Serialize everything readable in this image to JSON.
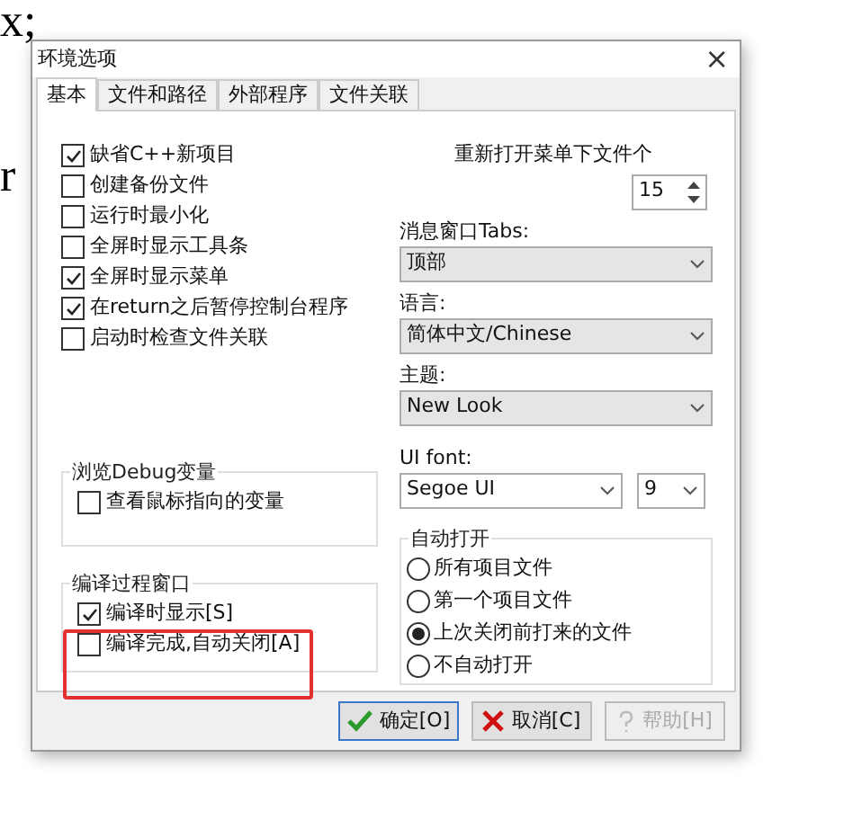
{
  "background_text": [
    "x;",
    "r"
  ],
  "window": {
    "title": "环境选项",
    "close": "×"
  },
  "tabs": [
    {
      "label": "基本",
      "selected": true
    },
    {
      "label": "文件和路径",
      "selected": false
    },
    {
      "label": "外部程序",
      "selected": false
    },
    {
      "label": "文件关联",
      "selected": false
    }
  ],
  "options": [
    {
      "label": "缺省C++新项目",
      "checked": true
    },
    {
      "label": "创建备份文件",
      "checked": false
    },
    {
      "label": "运行时最小化",
      "checked": false
    },
    {
      "label": "全屏时显示工具条",
      "checked": false
    },
    {
      "label": "全屏时显示菜单",
      "checked": true
    },
    {
      "label": "在return之后暂停控制台程序",
      "checked": true
    },
    {
      "label": "启动时检查文件关联",
      "checked": false
    }
  ],
  "debug_group": {
    "title": "浏览Debug变量",
    "options": [
      {
        "label": "查看鼠标指向的变量",
        "checked": false
      }
    ]
  },
  "compile_group": {
    "title": "编译过程窗口",
    "options": [
      {
        "label": "编译时显示[S]",
        "checked": true
      },
      {
        "label": "编译完成,自动关闭[A]",
        "checked": false
      }
    ]
  },
  "recent_files": {
    "label": "重新打开菜单下文件个",
    "value": "15"
  },
  "message_tabs": {
    "label": "消息窗口Tabs:",
    "value": "顶部"
  },
  "language": {
    "label": "语言:",
    "value": "简体中文/Chinese"
  },
  "theme": {
    "label": "主题:",
    "value": "New Look"
  },
  "ui_font": {
    "label": "UI font:",
    "value": "Segoe UI",
    "size": "9"
  },
  "auto_open": {
    "title": "自动打开",
    "options": [
      {
        "label": "所有项目文件",
        "selected": false
      },
      {
        "label": "第一个项目文件",
        "selected": false
      },
      {
        "label": "上次关闭前打来的文件",
        "selected": true
      },
      {
        "label": "不自动打开",
        "selected": false
      }
    ]
  },
  "buttons": [
    {
      "label": "确定[O]",
      "kind": "ok",
      "disabled": false
    },
    {
      "label": "取消[C]",
      "kind": "cancel",
      "disabled": false
    },
    {
      "label": "帮助[H]",
      "kind": "help",
      "disabled": true
    }
  ]
}
